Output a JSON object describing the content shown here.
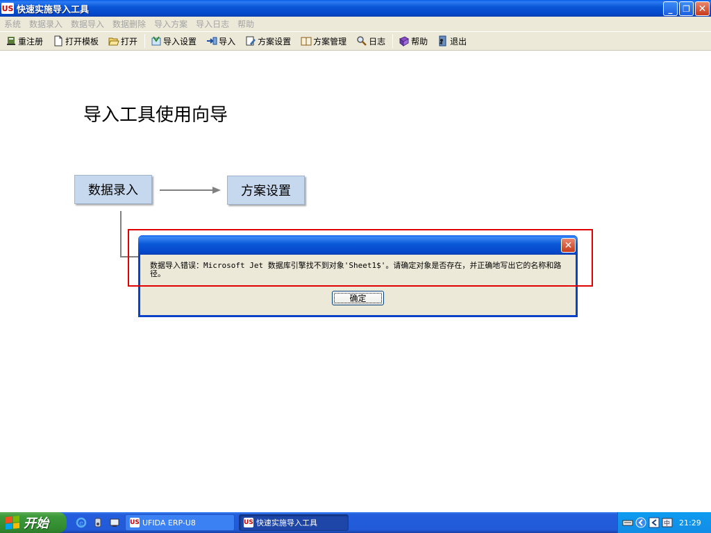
{
  "window": {
    "title": "快速实施导入工具",
    "logo_text": "US",
    "min_label": "_",
    "restore_label": "❐",
    "close_label": "✕"
  },
  "menu": {
    "items": [
      "系统",
      "数据录入",
      "数据导入",
      "数据删除",
      "导入方案",
      "导入日志",
      "帮助"
    ]
  },
  "toolbar": {
    "items": [
      {
        "label": "重注册",
        "icon": "register-icon"
      },
      {
        "label": "打开模板",
        "icon": "document-icon"
      },
      {
        "label": "打开",
        "icon": "folder-open-icon"
      },
      {
        "label": "导入设置",
        "icon": "import-settings-icon"
      },
      {
        "label": "导入",
        "icon": "import-icon"
      },
      {
        "label": "方案设置",
        "icon": "plan-settings-icon"
      },
      {
        "label": "方案管理",
        "icon": "plan-manage-icon"
      },
      {
        "label": "日志",
        "icon": "magnifier-icon"
      },
      {
        "label": "帮助",
        "icon": "help-book-icon"
      },
      {
        "label": "退出",
        "icon": "exit-icon"
      }
    ]
  },
  "wizard": {
    "title": "导入工具使用向导",
    "step1": "数据录入",
    "step2": "方案设置"
  },
  "dialog": {
    "message": "数据导入错误：Microsoft Jet 数据库引擎找不到对象'Sheet1$'。请确定对象是否存在，并正确地写出它的名称和路径。",
    "ok_label": "确定",
    "close_label": "✕"
  },
  "taskbar": {
    "start_label": "开始",
    "tasks": [
      {
        "label": "UFIDA ERP-U8"
      },
      {
        "label": "快速实施导入工具"
      }
    ],
    "clock": "21:29"
  },
  "colors": {
    "xp_blue": "#0447c9",
    "step_box": "#c5d8ee",
    "highlight_red": "#e00000",
    "dialog_bg": "#ece9d8"
  }
}
